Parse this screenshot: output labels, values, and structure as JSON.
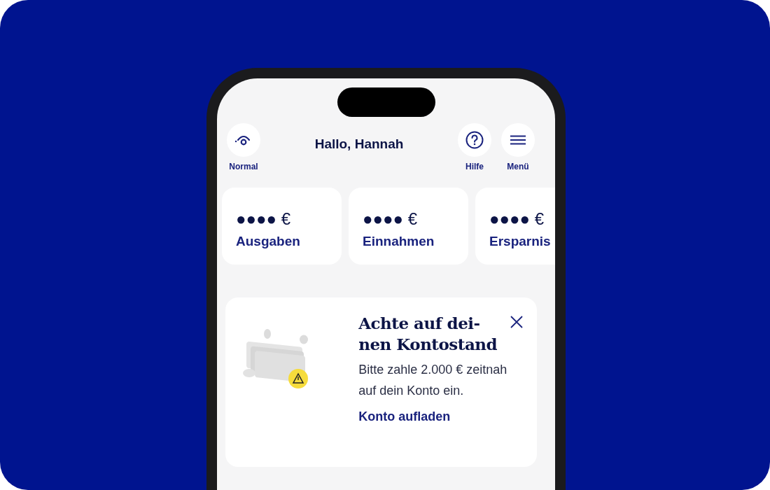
{
  "header": {
    "greeting": "Hallo, Hannah",
    "left_actions": [
      {
        "kind": "eye",
        "label": "Normal"
      }
    ],
    "right_actions": [
      {
        "kind": "help",
        "label": "Hilfe"
      },
      {
        "kind": "menu",
        "label": "Menü"
      }
    ]
  },
  "summary_cards": [
    {
      "amount": "●●●● €",
      "label": "Ausgaben"
    },
    {
      "amount": "●●●● €",
      "label": "Einnahmen"
    },
    {
      "amount": "●●●● €",
      "label": "Ersparnis"
    }
  ],
  "alert": {
    "title_lines": [
      "Achte auf dei-",
      "nen Kontostand"
    ],
    "text": "Bitte zahle 2.000 € zeitnah auf dein Konto ein.",
    "link": "Konto aufladen",
    "dismissible": true
  }
}
